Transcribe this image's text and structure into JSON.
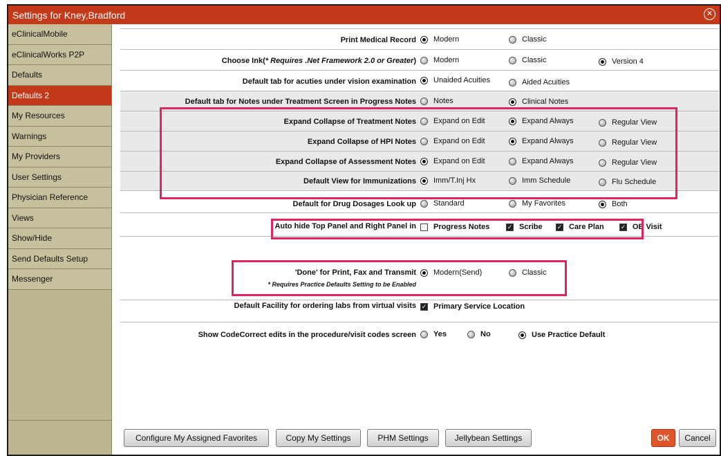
{
  "window": {
    "title": "Settings for Kney,Bradford"
  },
  "sidebar": {
    "items": [
      {
        "label": "eClinicalMobile"
      },
      {
        "label": "eClinicalWorks P2P"
      },
      {
        "label": "Defaults"
      },
      {
        "label": "Defaults 2",
        "active": true
      },
      {
        "label": "My Resources"
      },
      {
        "label": "Warnings"
      },
      {
        "label": "My Providers"
      },
      {
        "label": "User Settings"
      },
      {
        "label": "Physician Reference"
      },
      {
        "label": "Views"
      },
      {
        "label": "Show/Hide"
      },
      {
        "label": "Send Defaults Setup"
      },
      {
        "label": "Messenger"
      }
    ]
  },
  "settings": {
    "print": {
      "label": "Print Medical Record",
      "o1": "Modern",
      "o2": "Classic"
    },
    "ink": {
      "label_prefix": "Choose Ink(",
      "label_note": "* Requires .Net Framework 2.0 or Greater",
      "label_suffix": ")",
      "o1": "Modern",
      "o2": "Classic",
      "o3": "Version 4"
    },
    "acuities": {
      "label": "Default tab for acuties under vision examination",
      "o1": "Unaided Acuities",
      "o2": "Aided Acuities"
    },
    "notes_tab": {
      "label": "Default tab for Notes under Treatment Screen in Progress Notes",
      "o1": "Notes",
      "o2": "Clinical Notes"
    },
    "treatment": {
      "label": "Expand Collapse of Treatment Notes",
      "o1": "Expand on Edit",
      "o2": "Expand Always",
      "o3": "Regular View"
    },
    "hpi": {
      "label": "Expand Collapse of HPI Notes",
      "o1": "Expand on Edit",
      "o2": "Expand Always",
      "o3": "Regular View"
    },
    "assessment": {
      "label": "Expand Collapse of Assessment Notes",
      "o1": "Expand on Edit",
      "o2": "Expand Always",
      "o3": "Regular View"
    },
    "immunizations": {
      "label": "Default View for Immunizations",
      "o1": "Imm/T.Inj Hx",
      "o2": "Imm Schedule",
      "o3": "Flu Schedule"
    },
    "drug": {
      "label": "Default for Drug Dosages Look up",
      "o1": "Standard",
      "o2": "My Favorites",
      "o3": "Both"
    },
    "autohide": {
      "label": "Auto hide Top Panel and Right Panel in",
      "o1": "Progress Notes",
      "o2": "Scribe",
      "o3": "Care Plan",
      "o4": "OB Visit"
    },
    "done": {
      "label": "'Done' for Print, Fax and Transmit",
      "sublabel": "* Requires Practice Defaults Setting to be Enabled",
      "o1": "Modern(Send)",
      "o2": "Classic"
    },
    "facility": {
      "label": "Default Facility for ordering labs from virtual visits",
      "o1": "Primary Service Location"
    },
    "codecorrect": {
      "label": "Show CodeCorrect edits in the procedure/visit codes screen",
      "o1": "Yes",
      "o2": "No",
      "o3": "Use Practice Default"
    }
  },
  "footer": {
    "configure": "Configure My Assigned Favorites",
    "copy": "Copy My Settings",
    "phm": "PHM Settings",
    "jellybean": "Jellybean Settings",
    "ok": "OK",
    "cancel": "Cancel"
  },
  "colors": {
    "titlebar": "#c23a1a",
    "sidebar": "#bdb68f",
    "active_item": "#c23a1a",
    "highlight": "#e0245e",
    "ok_button": "#e0542a"
  }
}
